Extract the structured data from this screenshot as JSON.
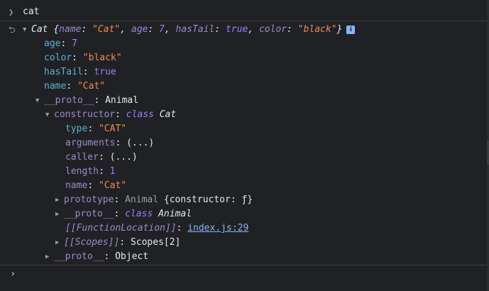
{
  "input": {
    "prompt_icon": "chevron-right-icon",
    "text": "cat"
  },
  "result": {
    "return_icon": "return-arrow-icon",
    "object_name": "Cat",
    "preview_open": "{",
    "p1_key": "name",
    "p1_val": "\"Cat\"",
    "p2_key": "age",
    "p2_val": "7",
    "p3_key": "hasTail",
    "p3_val": "true",
    "p4_key": "color",
    "p4_val": "\"black\"",
    "preview_close": "}",
    "info_label": "i",
    "props": [
      {
        "key": "age",
        "value": "7"
      },
      {
        "key": "color",
        "value": "\"black\""
      },
      {
        "key": "hasTail",
        "value": "true"
      },
      {
        "key": "name",
        "value": "\"Cat\""
      }
    ],
    "proto": {
      "key": "__proto__",
      "value": "Animal",
      "constructor": {
        "key": "constructor",
        "kw": "class",
        "name": "Cat",
        "type_key": "type",
        "type_val": "\"CAT\"",
        "arguments_key": "arguments",
        "arguments_val": "(...)",
        "caller_key": "caller",
        "caller_val": "(...)",
        "length_key": "length",
        "length_val": "1",
        "name_key": "name",
        "name_val": "\"Cat\"",
        "prototype_key": "prototype",
        "prototype_dim": "Animal",
        "prototype_val": "{constructor: ƒ}",
        "proto_key": "__proto__",
        "proto_kw": "class",
        "proto_name": "Animal",
        "fnloc_key": "[[FunctionLocation]]",
        "fnloc_val": "index.js:29",
        "scopes_key": "[[Scopes]]",
        "scopes_val": "Scopes[2]"
      },
      "next_proto_key": "__proto__",
      "next_proto_val": "Object"
    }
  },
  "prompt": {
    "caret_icon": "chevron-right-icon"
  },
  "colors": {
    "background": "#202124",
    "key": "#5db0d7",
    "string": "#f28b54",
    "number": "#9980ff",
    "link": "#8ab4f8"
  }
}
